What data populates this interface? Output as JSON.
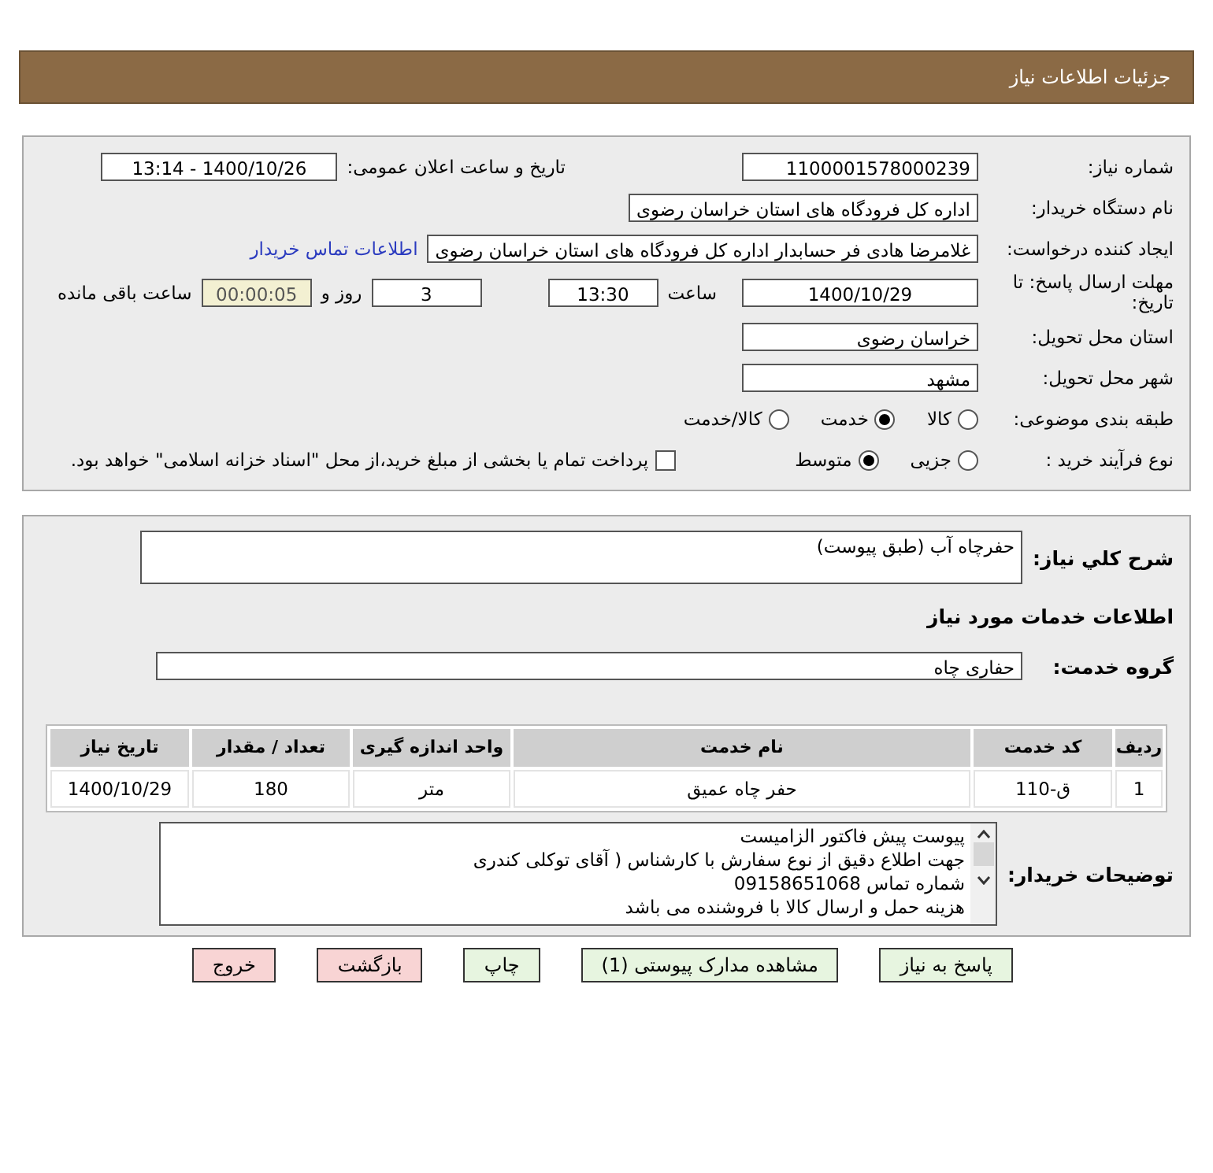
{
  "header": {
    "title": "جزئیات اطلاعات نیاز"
  },
  "need_number": {
    "label": "شماره نیاز:",
    "value": "1100001578000239"
  },
  "announce_datetime": {
    "label": "تاریخ و ساعت اعلان عمومی:",
    "value": "1400/10/26 - 13:14"
  },
  "buyer_org": {
    "label": "نام دستگاه خریدار:",
    "value": "اداره کل فرودگاه های استان خراسان رضوی"
  },
  "requester": {
    "label": "ایجاد کننده درخواست:",
    "value": "غلامرضا هادی فر حسابدار اداره کل فرودگاه های استان خراسان رضوی",
    "link": "اطلاعات تماس خریدار"
  },
  "deadline": {
    "label": "مهلت ارسال پاسخ: تا تاریخ:",
    "date": "1400/10/29",
    "time_label": "ساعت",
    "time": "13:30",
    "days": "3",
    "days_label": "روز و",
    "remaining": "00:00:05",
    "remaining_label": "ساعت باقی مانده"
  },
  "province": {
    "label": "استان محل تحویل:",
    "value": "خراسان رضوی"
  },
  "city": {
    "label": "شهر محل تحویل:",
    "value": "مشهد"
  },
  "category": {
    "label": "طبقه بندی موضوعی:",
    "options": [
      {
        "label": "کالا",
        "selected": false
      },
      {
        "label": "خدمت",
        "selected": true
      },
      {
        "label": "کالا/خدمت",
        "selected": false
      }
    ]
  },
  "process": {
    "label": "نوع فرآیند خرید :",
    "options": [
      {
        "label": "جزیی",
        "selected": false
      },
      {
        "label": "متوسط",
        "selected": true
      }
    ],
    "treasury": {
      "label": "پرداخت تمام یا بخشی از مبلغ خرید،از محل \"اسناد خزانه اسلامی\" خواهد بود.",
      "checked": false
    }
  },
  "summary": {
    "label": "شرح کلي نياز:",
    "value": "حفرچاه آب (طبق پیوست)"
  },
  "services_heading": "اطلاعات خدمات مورد نیاز",
  "service_group": {
    "label": "گروه خدمت:",
    "value": "حفاری چاه"
  },
  "table": {
    "columns": [
      "رديف",
      "کد خدمت",
      "نام خدمت",
      "واحد اندازه گیری",
      "تعداد / مقدار",
      "تاریخ نیاز"
    ],
    "rows": [
      [
        "1",
        "ق-110",
        "حفر چاه عمیق",
        "متر",
        "180",
        "1400/10/29"
      ]
    ]
  },
  "buyer_notes": {
    "label": "توضیحات خریدار:",
    "lines": [
      "پیوست پیش فاکتور الزامیست",
      "جهت اطلاع دقیق از نوع سفارش با کارشناس ( آقای توکلی کندری",
      "شماره تماس 09158651068",
      "هزینه حمل و ارسال کالا با فروشنده می باشد"
    ]
  },
  "buttons": [
    {
      "label": "پاسخ به نیاز",
      "kind": "normal"
    },
    {
      "label": "مشاهده مدارک پیوستی (1)",
      "kind": "normal"
    },
    {
      "label": "چاپ",
      "kind": "normal"
    },
    {
      "label": "بازگشت",
      "kind": "danger"
    },
    {
      "label": "خروج",
      "kind": "danger"
    }
  ]
}
